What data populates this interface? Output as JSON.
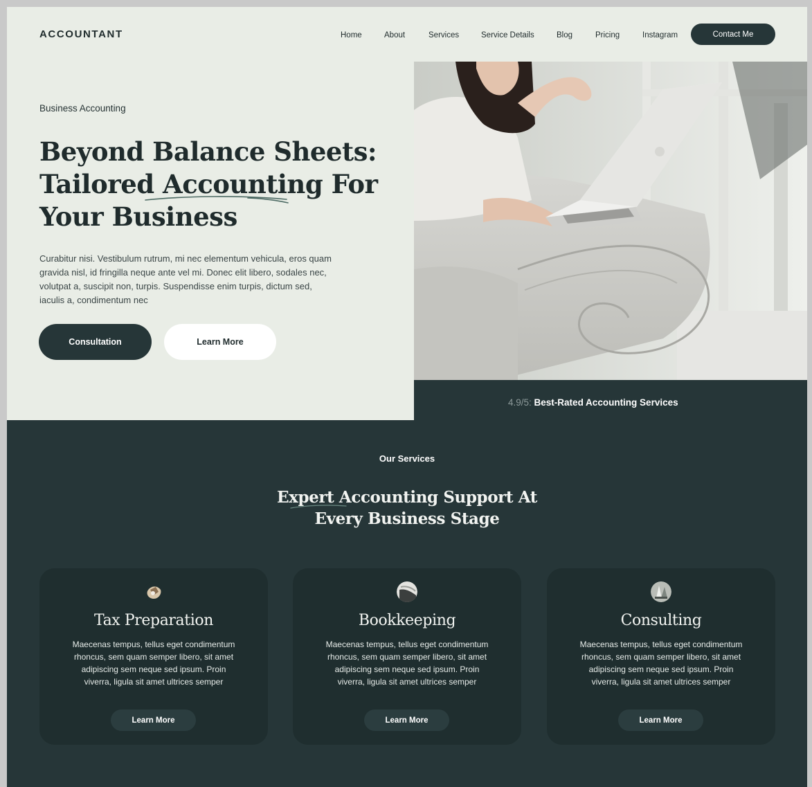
{
  "brand": {
    "logo": "ACCOUNTANT"
  },
  "nav": {
    "items": [
      "Home",
      "About",
      "Services",
      "Service Details",
      "Blog",
      "Pricing",
      "Instagram"
    ],
    "cta": "Contact Me"
  },
  "hero": {
    "eyebrow": "Business Accounting",
    "headline_lines": [
      "Beyond Balance Sheets:",
      "Tailored Accounting For",
      "Your Business"
    ],
    "lead": "Curabitur nisi. Vestibulum rutrum, mi nec elementum vehicula, eros quam gravida nisl, id fringilla neque ante vel mi. Donec elit libero, sodales nec, volutpat a, suscipit non, turpis. Suspendisse enim turpis, dictum sed, iaculis a, condimentum nec",
    "primary_cta": "Consultation",
    "secondary_cta": "Learn More",
    "image": "woman-with-laptop-on-sofa-photo"
  },
  "rating": {
    "score": "4.9/5:",
    "label": "Best-Rated Accounting Services"
  },
  "services": {
    "eyebrow": "Our Services",
    "title_lines": [
      "Expert Accounting Support At",
      "Every Business Stage"
    ],
    "cards": [
      {
        "icon": "tax-preparation-icon",
        "title": "Tax Preparation",
        "desc": "Maecenas tempus, tellus eget condimentum rhoncus, sem quam semper libero, sit amet adipiscing sem neque sed ipsum. Proin viverra, ligula sit amet ultrices semper",
        "cta": "Learn More"
      },
      {
        "icon": "bookkeeping-icon",
        "title": "Bookkeeping",
        "desc": "Maecenas tempus, tellus eget condimentum rhoncus, sem quam semper libero, sit amet adipiscing sem neque sed ipsum. Proin viverra, ligula sit amet ultrices semper",
        "cta": "Learn More"
      },
      {
        "icon": "consulting-icon",
        "title": "Consulting",
        "desc": "Maecenas tempus, tellus eget condimentum rhoncus, sem quam semper libero, sit amet adipiscing sem neque sed ipsum. Proin viverra, ligula sit amet ultrices semper",
        "cta": "Learn More"
      }
    ]
  },
  "colors": {
    "dark": "#263638",
    "card": "#1f2e2f",
    "light_bg": "#e9ede6",
    "accent_underline": "#4c6a63"
  }
}
